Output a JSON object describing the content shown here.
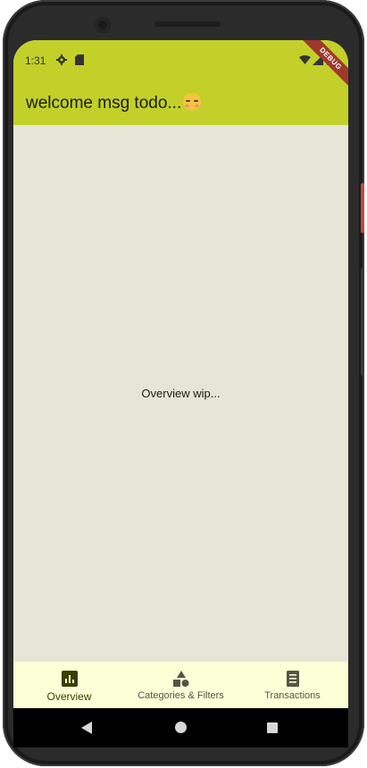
{
  "status_bar": {
    "time": "1:31"
  },
  "debug_banner": "DEBUG",
  "app_bar": {
    "title": "welcome msg todo..."
  },
  "main": {
    "placeholder_text": "Overview wip..."
  },
  "bottom_nav": {
    "items": [
      {
        "label": "Overview",
        "icon": "bar-chart-icon",
        "active": true
      },
      {
        "label": "Categories & Filters",
        "icon": "category-shapes-icon",
        "active": false
      },
      {
        "label": "Transactions",
        "icon": "receipt-icon",
        "active": false
      }
    ]
  },
  "colors": {
    "app_bar": "#c2d029",
    "background": "#e6e6d6",
    "bottom_nav": "#fdffd6",
    "debug_ribbon": "#a0392c"
  }
}
